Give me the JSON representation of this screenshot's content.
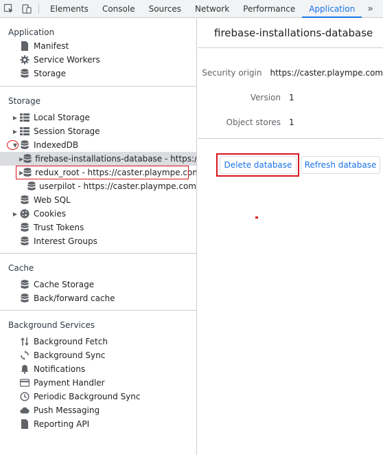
{
  "toolbar": {
    "tabs": [
      "Elements",
      "Console",
      "Sources",
      "Network",
      "Performance",
      "Application"
    ],
    "active_tab": "Application",
    "more": "»"
  },
  "sidebar": {
    "application": {
      "title": "Application",
      "items": [
        "Manifest",
        "Service Workers",
        "Storage"
      ]
    },
    "storage": {
      "title": "Storage",
      "local_storage": "Local Storage",
      "session_storage": "Session Storage",
      "indexeddb": "IndexedDB",
      "db_firebase": "firebase-installations-database - https://caster.plaympe.com",
      "db_redux": "redux_root - https://caster.plaympe.com",
      "db_userpilot": "userpilot - https://caster.plaympe.com",
      "web_sql": "Web SQL",
      "cookies": "Cookies",
      "trust_tokens": "Trust Tokens",
      "interest_groups": "Interest Groups"
    },
    "cache": {
      "title": "Cache",
      "items": [
        "Cache Storage",
        "Back/forward cache"
      ]
    },
    "background": {
      "title": "Background Services",
      "items": [
        "Background Fetch",
        "Background Sync",
        "Notifications",
        "Payment Handler",
        "Periodic Background Sync",
        "Push Messaging",
        "Reporting API"
      ]
    }
  },
  "main": {
    "db_name": "firebase-installations-database",
    "security_origin_label": "Security origin",
    "security_origin_value": "https://caster.plaympe.com",
    "version_label": "Version",
    "version_value": "1",
    "object_stores_label": "Object stores",
    "object_stores_value": "1",
    "delete_button": "Delete database",
    "refresh_button": "Refresh database"
  },
  "colors": {
    "accent": "#1a73e8",
    "annotation": "#d9141b",
    "selected_row": "#dadce0"
  }
}
